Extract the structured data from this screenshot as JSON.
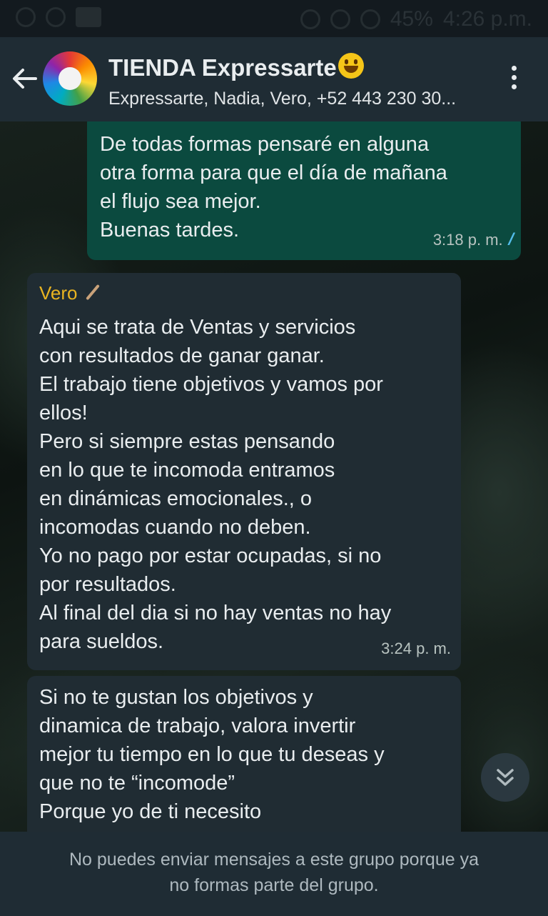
{
  "status_bar": {
    "battery": "45%",
    "time": "4:26 p.m."
  },
  "header": {
    "back_icon": "arrow-left-icon",
    "title": "TIENDA Expressarte",
    "title_emoji": "grinning-face-emoji",
    "subtitle": "Expressarte, Nadia, Vero, +52 443 230 30...",
    "menu_icon": "more-vertical-icon"
  },
  "messages": [
    {
      "direction": "outgoing",
      "text": "De todas formas pensaré en alguna\notra forma para que el día de mañana\nel flujo sea mejor.\nBuenas tardes.",
      "time": "3:18 p. m.",
      "status_icon": "double-check-read-icon"
    },
    {
      "direction": "incoming",
      "sender": "Vero",
      "sender_color": "#e9b421",
      "text": "Aqui se trata de Ventas y servicios\ncon resultados de ganar ganar.\nEl trabajo tiene objetivos y vamos por\nellos!\nPero si siempre estas pensando\nen lo que te incomoda entramos\nen dinámicas emocionales., o\nincomodas cuando no deben.\nYo no pago por estar ocupadas, si no\npor resultados.\nAl final del dia si no hay ventas no hay\npara sueldos.",
      "time": "3:24 p. m."
    },
    {
      "direction": "incoming",
      "text": "Si no te gustan los objetivos y\ndinamica de trabajo, valora invertir\nmejor tu tiempo en lo que tu deseas y\nque no te “incomode”\nPorque yo de ti necesito"
    }
  ],
  "scroll_button_icon": "chevron-double-down-icon",
  "footer": {
    "text": "No puedes enviar mensajes a este grupo porque ya\nno formas parte del grupo."
  },
  "colors": {
    "header_bg": "#1f2c34",
    "outgoing_bubble": "#0b4a3f",
    "incoming_bubble": "#202c33",
    "read_ticks": "#53bdeb"
  }
}
